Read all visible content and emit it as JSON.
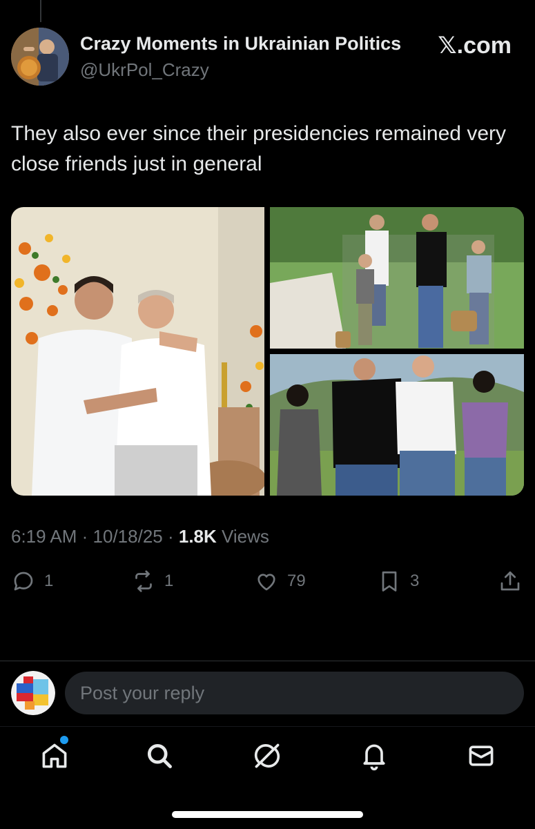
{
  "tweet": {
    "display_name": "Crazy Moments in Ukrainian Politics",
    "handle": "@UkrPol_Crazy",
    "brand": "𝕏.com",
    "text": "They also ever since their presidencies remained very close friends just in general",
    "time": "6:19 AM",
    "date": "10/18/25",
    "views_count": "1.8K",
    "views_label": "Views"
  },
  "actions": {
    "replies": "1",
    "reposts": "1",
    "likes": "79",
    "bookmarks": "3"
  },
  "reply_box": {
    "placeholder": "Post your reply"
  },
  "nav": {
    "items": [
      "home-icon",
      "search-icon",
      "grok-icon",
      "notifications-icon",
      "messages-icon"
    ]
  },
  "colors": {
    "accent": "#1d9bf0",
    "muted": "#71767b",
    "text": "#e7e9ea",
    "background": "#000000"
  }
}
